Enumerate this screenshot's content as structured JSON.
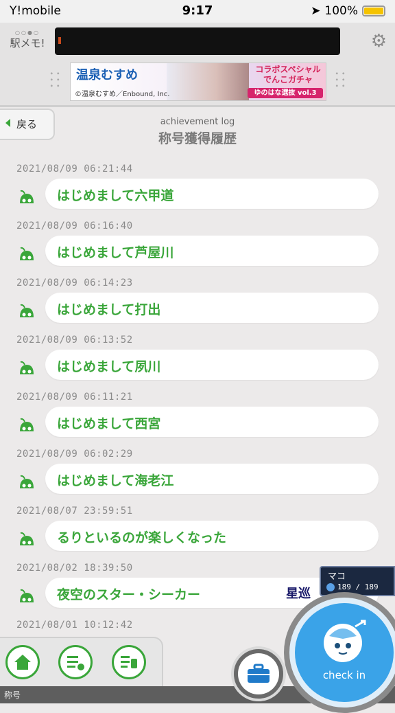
{
  "status_bar": {
    "carrier": "Y!mobile",
    "time": "9:17",
    "battery": "100%"
  },
  "header": {
    "logo_text": "駅メモ!",
    "banner": {
      "title": "温泉むすめ",
      "credit": "©温泉むすめ／Enbound, Inc.",
      "promo": "コラボスペシャル でんこガチャ",
      "sub": "ゆのはな選抜 vol.3"
    }
  },
  "back_label": "戻る",
  "subtitle": "achievement log",
  "title": "称号獲得履歴",
  "accent_color": "#3aa63a",
  "entries": [
    {
      "date": "2021/08/09 06:21:44",
      "text": "はじめまして六甲道"
    },
    {
      "date": "2021/08/09 06:16:40",
      "text": "はじめまして芦屋川"
    },
    {
      "date": "2021/08/09 06:14:23",
      "text": "はじめまして打出"
    },
    {
      "date": "2021/08/09 06:13:52",
      "text": "はじめまして夙川"
    },
    {
      "date": "2021/08/09 06:11:21",
      "text": "はじめまして西宮"
    },
    {
      "date": "2021/08/09 06:02:29",
      "text": "はじめまして海老江"
    },
    {
      "date": "2021/08/07 23:59:51",
      "text": "るりといるのが楽しくなった"
    },
    {
      "date": "2021/08/02 18:39:50",
      "text": "夜空のスター・シーカー"
    },
    {
      "date": "2021/08/01 10:12:42",
      "text": ""
    }
  ],
  "hp_panel": {
    "name": "マコ",
    "hp": "189 / 189"
  },
  "star_label": "星巡",
  "checkin_label": "check in",
  "bottom_label": "称号"
}
